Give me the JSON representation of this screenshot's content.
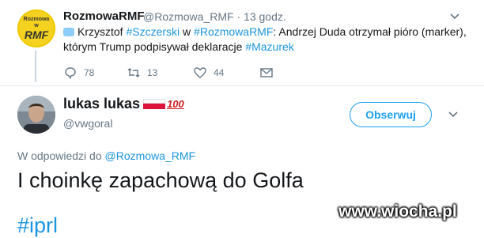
{
  "parent": {
    "avatar": {
      "line1": "Rozmowa",
      "line2": "w",
      "line3": "RMF"
    },
    "name": "RozmowaRMF",
    "handle": "@Rozmowa_RMF",
    "separator": "·",
    "time": "13 godz.",
    "text": {
      "a": "Krzysztof ",
      "tag1": "#Szczerski",
      "b": " w ",
      "tag2": "#RozmowaRMF",
      "c": ": Andrzej Duda otrzymał pióro (marker),",
      "d": "którym Trump podpisywał deklaracje ",
      "tag3": "#Mazurek"
    },
    "actions": {
      "replies": "78",
      "retweets": "13",
      "likes": "44"
    }
  },
  "tweet": {
    "name": "lukas lukas",
    "emoji_100": "100",
    "handle": "@vwgoral",
    "follow_label": "Obserwuj",
    "reply_prefix": "W odpowiedzi do ",
    "reply_handle": "@Rozmowa_RMF",
    "text": "I choinkę zapachową do Golfa",
    "hashtag": "#iprl"
  },
  "watermark": "www.wiocha.pl",
  "colors": {
    "link": "#1b95e0",
    "follow": "#1da1f2",
    "muted": "#657786"
  },
  "icons": [
    "chat-emoji-icon",
    "reply-icon",
    "retweet-icon",
    "like-icon",
    "message-icon",
    "chevron-down-icon",
    "poland-flag-icon",
    "hundred-points-icon"
  ]
}
